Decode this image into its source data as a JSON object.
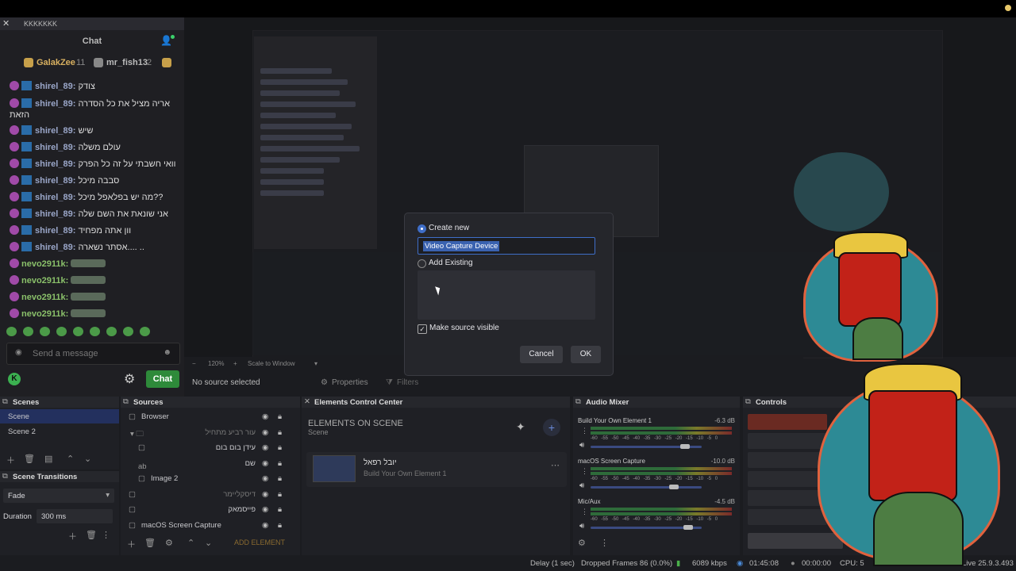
{
  "chat": {
    "window_title": "KKKKKKK",
    "title": "Chat",
    "leaderboard": [
      {
        "name": "GalakZee",
        "count": "11"
      },
      {
        "name": "mr_fish13",
        "count": "2"
      }
    ],
    "messages": [
      {
        "user": "shirel_89:",
        "text": "צודק"
      },
      {
        "user": "shirel_89:",
        "text": "אריה מציל את כל הסדרה הזאת"
      },
      {
        "user": "shirel_89:",
        "text": "שיש"
      },
      {
        "user": "shirel_89:",
        "text": "עולם משלה"
      },
      {
        "user": "shirel_89:",
        "text": "וואי חשבתי על זה כל הפרק"
      },
      {
        "user": "shirel_89:",
        "text": "סבבה מיכל"
      },
      {
        "user": "shirel_89:",
        "text": "מה יש בפלאפל מיכל??"
      },
      {
        "user": "shirel_89:",
        "text": "אני שונאת את השם שלה"
      },
      {
        "user": "shirel_89:",
        "text": "וון אתה מפחיד"
      },
      {
        "user": "shirel_89:",
        "text": "אסתר נשארה.... .."
      },
      {
        "user": "nevo2911k:",
        "text": ""
      },
      {
        "user": "nevo2911k:",
        "text": ""
      },
      {
        "user": "nevo2911k:",
        "text": ""
      },
      {
        "user": "nevo2911k:",
        "text": ""
      }
    ],
    "send_placeholder": "Send a message",
    "chat_button": "Chat",
    "k_logo": "K"
  },
  "preview": {
    "zoom": "120%",
    "scale_mode": "Scale to Window",
    "no_source": "No source selected",
    "properties": "Properties",
    "filters": "Filters"
  },
  "dialog": {
    "create_new": "Create new",
    "source_name": "Video Capture Device",
    "add_existing": "Add Existing",
    "make_visible": "Make source visible",
    "cancel": "Cancel",
    "ok": "OK"
  },
  "scenes": {
    "title": "Scenes",
    "items": [
      "Scene",
      "Scene 2"
    ]
  },
  "transitions": {
    "title": "Scene Transitions",
    "type": "Fade",
    "duration_label": "Duration",
    "duration_value": "300 ms"
  },
  "sources": {
    "title": "Sources",
    "items": [
      "Browser",
      "עור רביע מתחיל",
      "עידן בום בום",
      "שם",
      "Image 2",
      "דיסקליימר",
      "פייסמאק",
      "macOS Screen Capture"
    ],
    "text_icon": "ab"
  },
  "elements": {
    "title": "Elements Control Center",
    "heading": "ELEMENTS ON SCENE",
    "scene": "Scene",
    "item_name": "יובל רפאל",
    "item_sub": "Build Your Own Element 1",
    "add_element": "ADD ELEMENT"
  },
  "mixer": {
    "title": "Audio Mixer",
    "channels": [
      {
        "name": "Build Your Own Element 1",
        "db": "-6.3 dB",
        "level": 0.85
      },
      {
        "name": "macOS Screen Capture",
        "db": "-10.0 dB",
        "level": 0.75
      },
      {
        "name": "Mic/Aux",
        "db": "-4.5 dB",
        "level": 0.88
      }
    ],
    "ticks": "-60 -55 -50 -45 -40 -35 -30 -25 -20 -15 -10 -5 0"
  },
  "controls": {
    "title": "Controls"
  },
  "status": {
    "delay": "Delay (1 sec)",
    "dropped": "Dropped Frames 86 (0.0%)",
    "bitrate": "6089 kbps",
    "live_time": "01:45:08",
    "rec_time": "00:00:00",
    "cpu": "CPU: 5",
    "version": "Live 25.9.3.493"
  },
  "colors": {
    "accent": "#3f6ec8",
    "chat_green": "#2e8a3a",
    "hair": "#2d8a95",
    "face": "#c22218"
  }
}
